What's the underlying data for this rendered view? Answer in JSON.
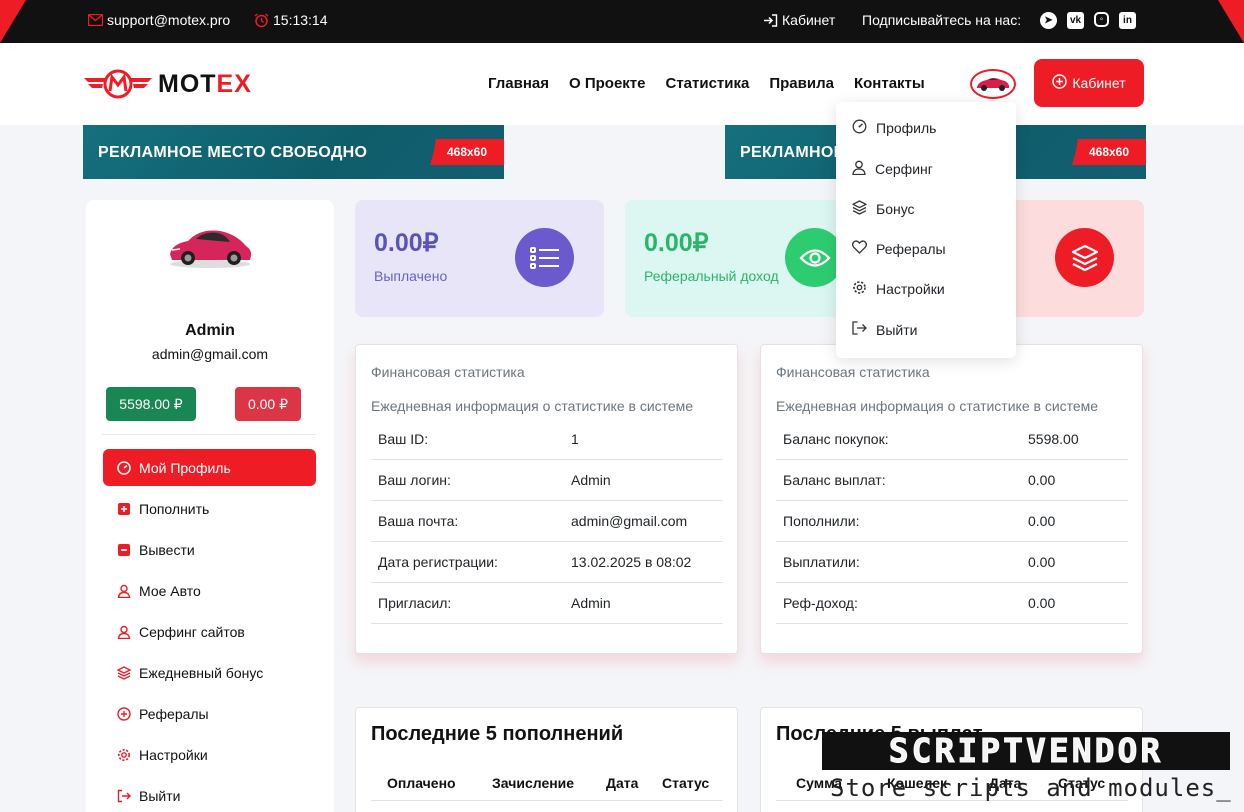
{
  "topbar": {
    "email": "support@motex.pro",
    "time": "15:13:14",
    "cabinet": "Кабинет",
    "subscribe": "Подписывайтесь на нас:",
    "socials": [
      "telegram-icon",
      "vk-icon",
      "instagram-icon",
      "linkedin-icon"
    ]
  },
  "header": {
    "logo": "MOTEX",
    "logo_a": "MOT",
    "logo_b": "EX",
    "nav": [
      "Главная",
      "О Проекте",
      "Статистика",
      "Правила",
      "Контакты"
    ],
    "cabinet_button": "Кабинет"
  },
  "banners": [
    {
      "text": "РЕКЛАМНОЕ  МЕСТО СВОБОДНО",
      "tag": "468x60"
    },
    {
      "text": "РЕКЛАМНОЕ  МЕСТО СВОБОДНО",
      "tag": "468x60"
    }
  ],
  "sidebar": {
    "name": "Admin",
    "email": "admin@gmail.com",
    "balance_green": "5598.00 ₽",
    "balance_red": "0.00 ₽",
    "items": [
      {
        "label": "Мой Профиль",
        "icon": "gauge-icon"
      },
      {
        "label": "Пополнить",
        "icon": "plus-square-icon"
      },
      {
        "label": "Вывести",
        "icon": "minus-square-icon"
      },
      {
        "label": "Мое Авто",
        "icon": "user-icon"
      },
      {
        "label": "Серфинг сайтов",
        "icon": "user-icon"
      },
      {
        "label": "Ежедневный бонус",
        "icon": "layers-icon"
      },
      {
        "label": "Рефералы",
        "icon": "plus-circle-icon"
      },
      {
        "label": "Настройки",
        "icon": "gear-icon"
      },
      {
        "label": "Выйти",
        "icon": "logout-icon"
      }
    ]
  },
  "stats": [
    {
      "value": "0.00₽",
      "label": "Выплачено",
      "icon": "list-icon"
    },
    {
      "value": "0.00₽",
      "label": "Реферальный доход",
      "icon": "eye-icon"
    },
    {
      "value": "",
      "label": "",
      "icon": "layers-icon"
    }
  ],
  "panel_left": {
    "heading": "Финансовая статистика",
    "subheading": "Ежедневная информация о статистике в системе",
    "rows": [
      {
        "k": "Ваш ID:",
        "v": "1"
      },
      {
        "k": "Ваш логин:",
        "v": "Admin"
      },
      {
        "k": "Ваша почта:",
        "v": "admin@gmail.com"
      },
      {
        "k": "Дата регистрации:",
        "v": "13.02.2025 в 08:02"
      },
      {
        "k": "Пригласил:",
        "v": "Admin"
      }
    ]
  },
  "panel_right": {
    "heading": "Финансовая статистика",
    "subheading": "Ежедневная информация о статистике в системе",
    "rows": [
      {
        "k": "Баланс покупок:",
        "v": "5598.00"
      },
      {
        "k": "Баланс выплат:",
        "v": "0.00"
      },
      {
        "k": "Пополнили:",
        "v": "0.00"
      },
      {
        "k": "Выплатили:",
        "v": "0.00"
      },
      {
        "k": "Реф-доход:",
        "v": "0.00"
      }
    ]
  },
  "deposits": {
    "title": "Последние 5 пополнений",
    "columns": [
      "Оплачено",
      "Зачисление",
      "Дата",
      "Статус"
    ]
  },
  "payouts": {
    "title": "Последние 5 выплат",
    "columns": [
      "Сумма",
      "Кошелек",
      "Дата",
      "Статус"
    ]
  },
  "dropdown": {
    "items": [
      {
        "label": "Профиль",
        "icon": "gauge-icon"
      },
      {
        "label": "Серфинг",
        "icon": "user-icon"
      },
      {
        "label": "Бонус",
        "icon": "layers-icon"
      },
      {
        "label": "Рефералы",
        "icon": "heart-icon"
      },
      {
        "label": "Настройки",
        "icon": "gear-icon"
      },
      {
        "label": "Выйти",
        "icon": "logout-icon"
      }
    ]
  },
  "watermark": {
    "top": "SCRIPTVENDOR",
    "bottom": "Store scripts and modules_"
  },
  "colors": {
    "accent": "#ee1c25",
    "purple": "#6a5acd",
    "green": "#2ecc71",
    "stat_purple_bg": "#e7e5f7",
    "stat_green_bg": "#dcf6f2",
    "stat_red_bg": "#fcdcdc"
  }
}
